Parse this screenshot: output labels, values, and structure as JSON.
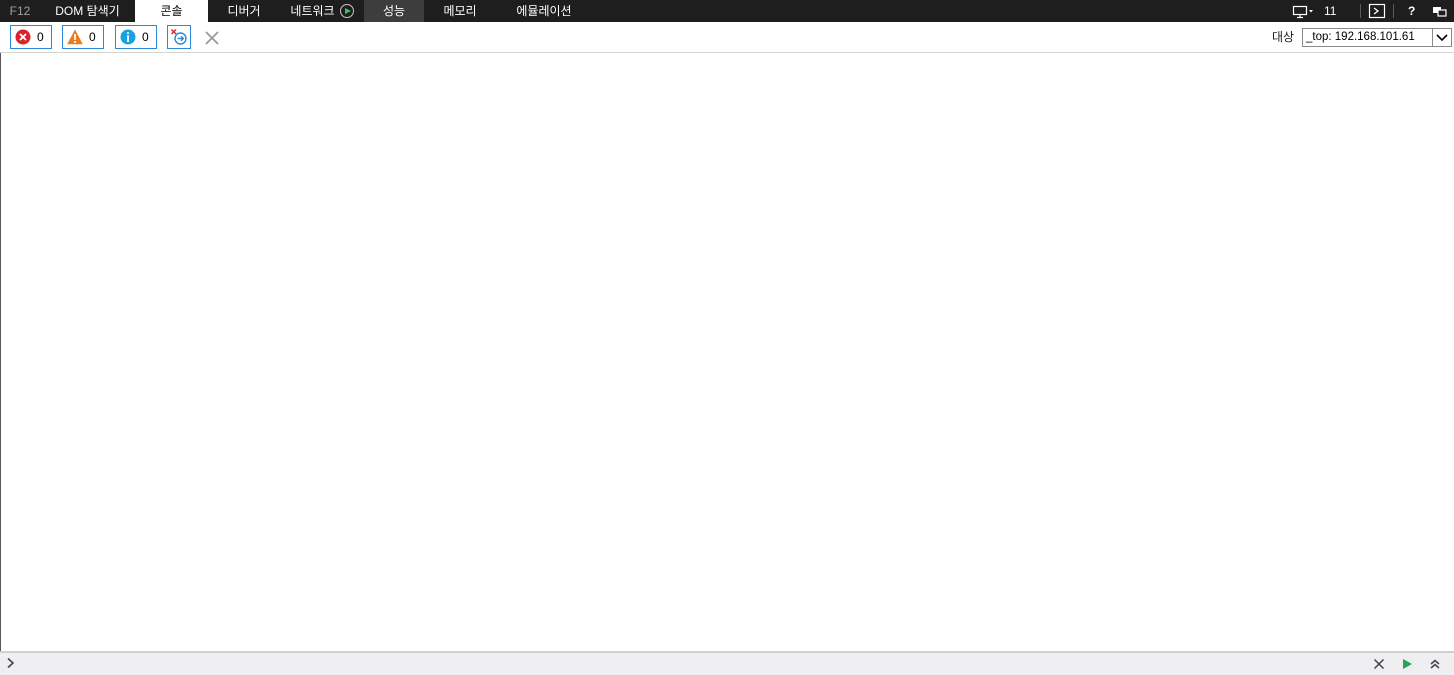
{
  "tabs": {
    "f12": "F12",
    "items": [
      {
        "label": "DOM 탐색기",
        "state": "normal"
      },
      {
        "label": "콘솔",
        "state": "active"
      },
      {
        "label": "디버거",
        "state": "normal"
      },
      {
        "label": "네트워크",
        "state": "normal"
      },
      {
        "label": "성능",
        "state": "hover"
      },
      {
        "label": "메모리",
        "state": "normal"
      },
      {
        "label": "에뮬레이션",
        "state": "normal"
      }
    ],
    "right": {
      "browser_version": "11",
      "help": "?"
    }
  },
  "toolbar": {
    "errors_count": "0",
    "warnings_count": "0",
    "info_count": "0",
    "target_label": "대상",
    "target_value": "_top: 192.168.101.61"
  },
  "input": {
    "value": "",
    "placeholder": ""
  },
  "colors": {
    "tabbar_bg": "#1e1e1e",
    "hover_tab_bg": "#3d3d3d",
    "filter_border": "#2e88d6",
    "error_red": "#d9232e",
    "warning_orange": "#ec7b1f",
    "info_blue": "#1ba1e2",
    "run_green": "#25a35a"
  },
  "icons": [
    "network-capture-play-icon",
    "monitor-icon",
    "console-prompt-icon",
    "help-icon",
    "undock-icon",
    "error-icon",
    "warning-icon",
    "info-icon",
    "clear-on-navigate-icon",
    "clear-console-icon",
    "chevron-prompt-icon",
    "clear-input-icon",
    "run-icon",
    "expand-multiline-icon"
  ]
}
